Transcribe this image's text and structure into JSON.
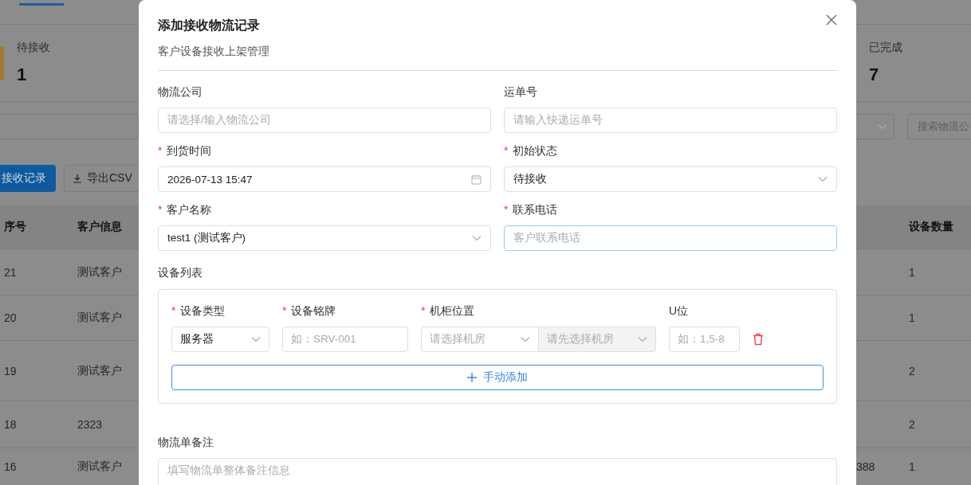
{
  "stats": [
    {
      "label": "待接收",
      "value": "1"
    },
    {
      "label": "已完成",
      "value": "7"
    }
  ],
  "search": {
    "placeholder": "搜索物流公"
  },
  "toolbar": [
    {
      "label": "接收记录",
      "kind": "primary"
    },
    {
      "label": "导出CSV",
      "kind": "export"
    }
  ],
  "table": {
    "columns": [
      "序号",
      "客户信息",
      "设备数量"
    ],
    "rows": [
      {
        "index": "21",
        "customer": "测试客户",
        "devices": "1"
      },
      {
        "index": "20",
        "customer": "测试客户",
        "devices": "1"
      },
      {
        "index": "19",
        "customer": "测试客户",
        "devices": "2"
      },
      {
        "index": "18",
        "customer": "2323",
        "devices": "2"
      },
      {
        "index": "16",
        "customer": "测试客户",
        "column_3": "388",
        "devices": "1"
      }
    ]
  },
  "dialog": {
    "required_mark": "*",
    "title": "添加接收物流记录",
    "subtitle": "客户设备接收上架管理",
    "fields": [
      {
        "label": "物流公司",
        "required": false,
        "kind": "input",
        "placeholder": "请选择/输入物流公司",
        "focused": false
      },
      {
        "label": "运单号",
        "required": false,
        "kind": "input",
        "placeholder": "请输入快递运单号",
        "focused": false
      },
      {
        "label": "到货时间",
        "required": true,
        "kind": "date",
        "value": "2026-07-13 15:47",
        "focused": false
      },
      {
        "label": "初始状态",
        "required": true,
        "kind": "select",
        "value": "待接收",
        "focused": false
      },
      {
        "label": "客户名称",
        "required": true,
        "kind": "select",
        "value": "test1 (测试客户)",
        "focused": false
      },
      {
        "label": "联系电话",
        "required": true,
        "kind": "input",
        "placeholder": "客户联系电话",
        "focused": true
      }
    ],
    "device_list": {
      "label": "设备列表",
      "columns": [
        {
          "label": "设备类型",
          "required": true
        },
        {
          "label": "设备铭牌",
          "required": true
        },
        {
          "label": "机柜位置",
          "required": true
        },
        {
          "label": "U位",
          "required": false
        }
      ],
      "devices": [
        {
          "type": "服务器",
          "nameplate_placeholder": "如：SRV-001",
          "room_placeholder": "请选择机房",
          "rack_placeholder": "请先选择机房",
          "rack_disabled": true,
          "u_placeholder": "如：1,5-8"
        }
      ],
      "add_button": "手动添加"
    },
    "remark": {
      "label": "物流单备注",
      "placeholder": "填写物流单整体备注信息"
    }
  }
}
